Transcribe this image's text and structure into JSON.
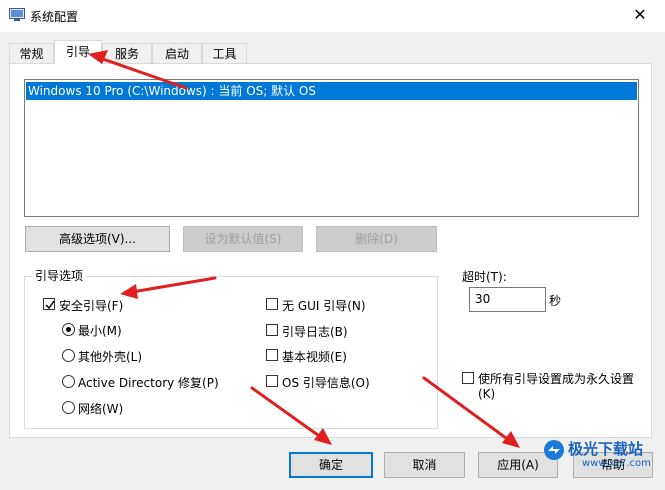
{
  "window": {
    "title": "系统配置",
    "close_glyph": "✕"
  },
  "tabs": [
    {
      "label": "常规"
    },
    {
      "label": "引导"
    },
    {
      "label": "服务"
    },
    {
      "label": "启动"
    },
    {
      "label": "工具"
    }
  ],
  "active_tab": "引导",
  "boot_list": {
    "selected_item": "Windows 10 Pro (C:\\Windows) : 当前 OS; 默认 OS"
  },
  "boot_buttons": {
    "advanced": "高级选项(V)...",
    "set_default": "设为默认值(S)",
    "delete": "删除(D)"
  },
  "boot_options": {
    "group_label": "引导选项",
    "safe_boot": {
      "label": "安全引导(F)",
      "checked": true
    },
    "radios": [
      {
        "label": "最小(M)",
        "selected": true
      },
      {
        "label": "其他外壳(L)",
        "selected": false
      },
      {
        "label": "Active Directory 修复(P)",
        "selected": false
      },
      {
        "label": "网络(W)",
        "selected": false
      }
    ],
    "checkboxes": [
      {
        "label": "无 GUI 引导(N)",
        "checked": false
      },
      {
        "label": "引导日志(B)",
        "checked": false
      },
      {
        "label": "基本视频(E)",
        "checked": false
      },
      {
        "label": "OS 引导信息(O)",
        "checked": false
      }
    ]
  },
  "timeout": {
    "label": "超时(T):",
    "value": "30",
    "unit": "秒"
  },
  "permanent": {
    "label_line1": "使所有引导设置成为永久设置",
    "label_line2": "(K)",
    "checked": false
  },
  "footer_buttons": {
    "ok": "确定",
    "cancel": "取消",
    "apply": "应用(A)",
    "help": "帮助"
  },
  "watermark": {
    "text": "极光下载站",
    "url": "www.xz7.com"
  },
  "colors": {
    "selection": "#0078d7",
    "annotation_arrow": "#e02020"
  }
}
